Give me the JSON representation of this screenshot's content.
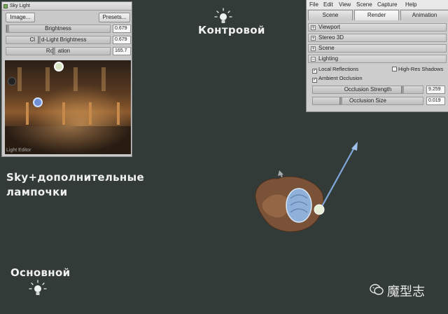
{
  "sky_light": {
    "title": "Sky Light",
    "image_button": "Image...",
    "presets_button": "Presets...",
    "rows": [
      {
        "label": "Brightness",
        "value": "0.679"
      },
      {
        "label": "Cl    d-Light Brightness",
        "value": "0.679"
      },
      {
        "label": "Ro   ation",
        "value": "165.7"
      }
    ],
    "light_editor_label": "Light Editor"
  },
  "render_panel": {
    "menu": [
      "File",
      "Edit",
      "View",
      "Scene",
      "Capture",
      "Help"
    ],
    "tabs": [
      "Scene",
      "Render",
      "Animation"
    ],
    "active_tab": "Render",
    "sections": {
      "viewport": "Viewport",
      "stereo": "Stereo 3D",
      "scene": "Scene",
      "lighting": "Lighting"
    },
    "local_reflections": "Local Reflections",
    "high_res_shadows": "High-Res Shadows",
    "ambient_occlusion": "Ambient Occlusion",
    "occlusion_strength": {
      "label": "Occlusion Strength",
      "value": "9.259"
    },
    "occlusion_size": {
      "label": "Occlusion Size",
      "value": "0.019"
    }
  },
  "scene": {
    "back_light_label": "Контровой",
    "sky_label_line1": "Sky+дополнительные",
    "sky_label_line2": "лампочки",
    "main_light_label": "Основной",
    "watermark": "魔型志"
  },
  "colors": {
    "background": "#323b38",
    "panel": "#cdcdcd",
    "arrow": "#8fb6e6"
  }
}
